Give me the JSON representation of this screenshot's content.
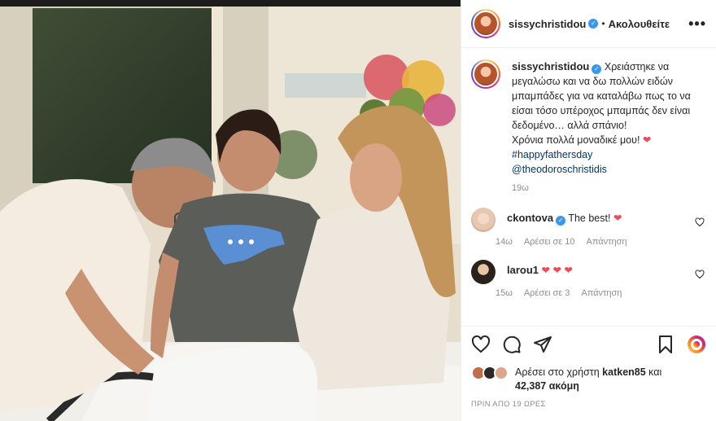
{
  "post": {
    "author": "sissychristidou",
    "follow_status": "Ακολουθείτε",
    "separator": "•",
    "more_icon": "more-options-icon",
    "caption_lines": [
      "Χρειάστηκε να μεγαλώσω και να δω πολλών ειδών μπαμπάδες για να καταλάβω πως το να είσαι τόσο υπέροχος μπαμπάς δεν είναι δεδομένο… αλλά σπάνιο!",
      "Χρόνια πολλά μοναδικέ μου!"
    ],
    "hashtag": "#happyfathersday",
    "mention": "@theodoroschristidis",
    "time_ago": "19ω"
  },
  "comments": [
    {
      "user": "ckontova",
      "text": "The best!",
      "time": "14ω",
      "likes": "Αρέσει σε 10",
      "reply": "Απάντηση",
      "verified": true,
      "hearts": 1
    },
    {
      "user": "larou1",
      "text": "",
      "time": "15ω",
      "likes": "Αρέσει σε 3",
      "reply": "Απάντηση",
      "verified": false,
      "hearts": 3
    }
  ],
  "actions": {
    "like_icon": "heart-icon",
    "comment_icon": "comment-icon",
    "share_icon": "share-icon",
    "save_icon": "bookmark-icon",
    "reel_icon": "reel-icon"
  },
  "likes": {
    "prefix": "Αρέσει στο χρήστη",
    "user": "katken85",
    "conj": "και",
    "count": "42,387",
    "suffix": "ακόμη"
  },
  "posted": "ΠΡΙΝ ΑΠΟ 19 ΩΡΕΣ",
  "colors": {
    "accent": "#3897f0",
    "heart": "#ed4956",
    "muted": "#8e8e8e",
    "link": "#00376b"
  }
}
